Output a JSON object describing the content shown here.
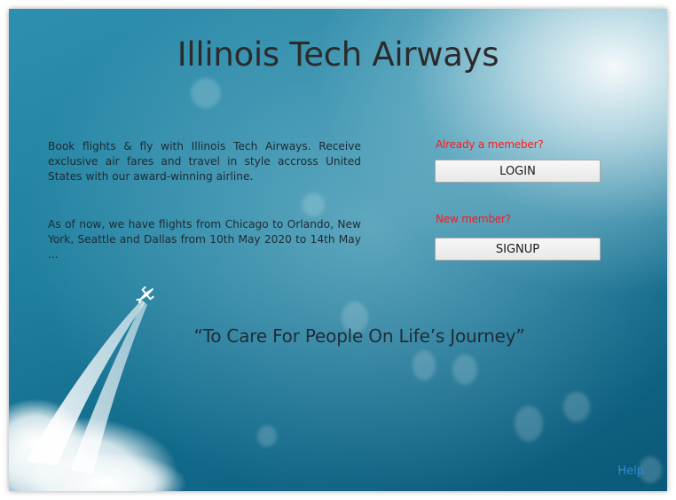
{
  "app": {
    "title": "Illinois Tech Airways"
  },
  "intro": {
    "paragraph1": "Book flights & fly with Illinois Tech Airways. Receive exclusive air fares and travel in style accross United States with our award-winning airline.",
    "paragraph2": "As of now, we have flights from Chicago to Orlando, New York, Seattle and Dallas from 10th May 2020 to 14th May ..."
  },
  "auth": {
    "login_prompt": "Already a memeber?",
    "login_label": "LOGIN",
    "signup_prompt": "New member?",
    "signup_label": "SIGNUP"
  },
  "slogan": "“To Care For People On Life’s Journey”",
  "footer": {
    "help_label": "Help"
  },
  "colors": {
    "prompt": "#ff1a1a",
    "help_link": "#2a8fd0",
    "background_dark": "#0c5878",
    "background_light": "#2f8fae"
  },
  "icons": {
    "plane": "airplane-icon"
  }
}
